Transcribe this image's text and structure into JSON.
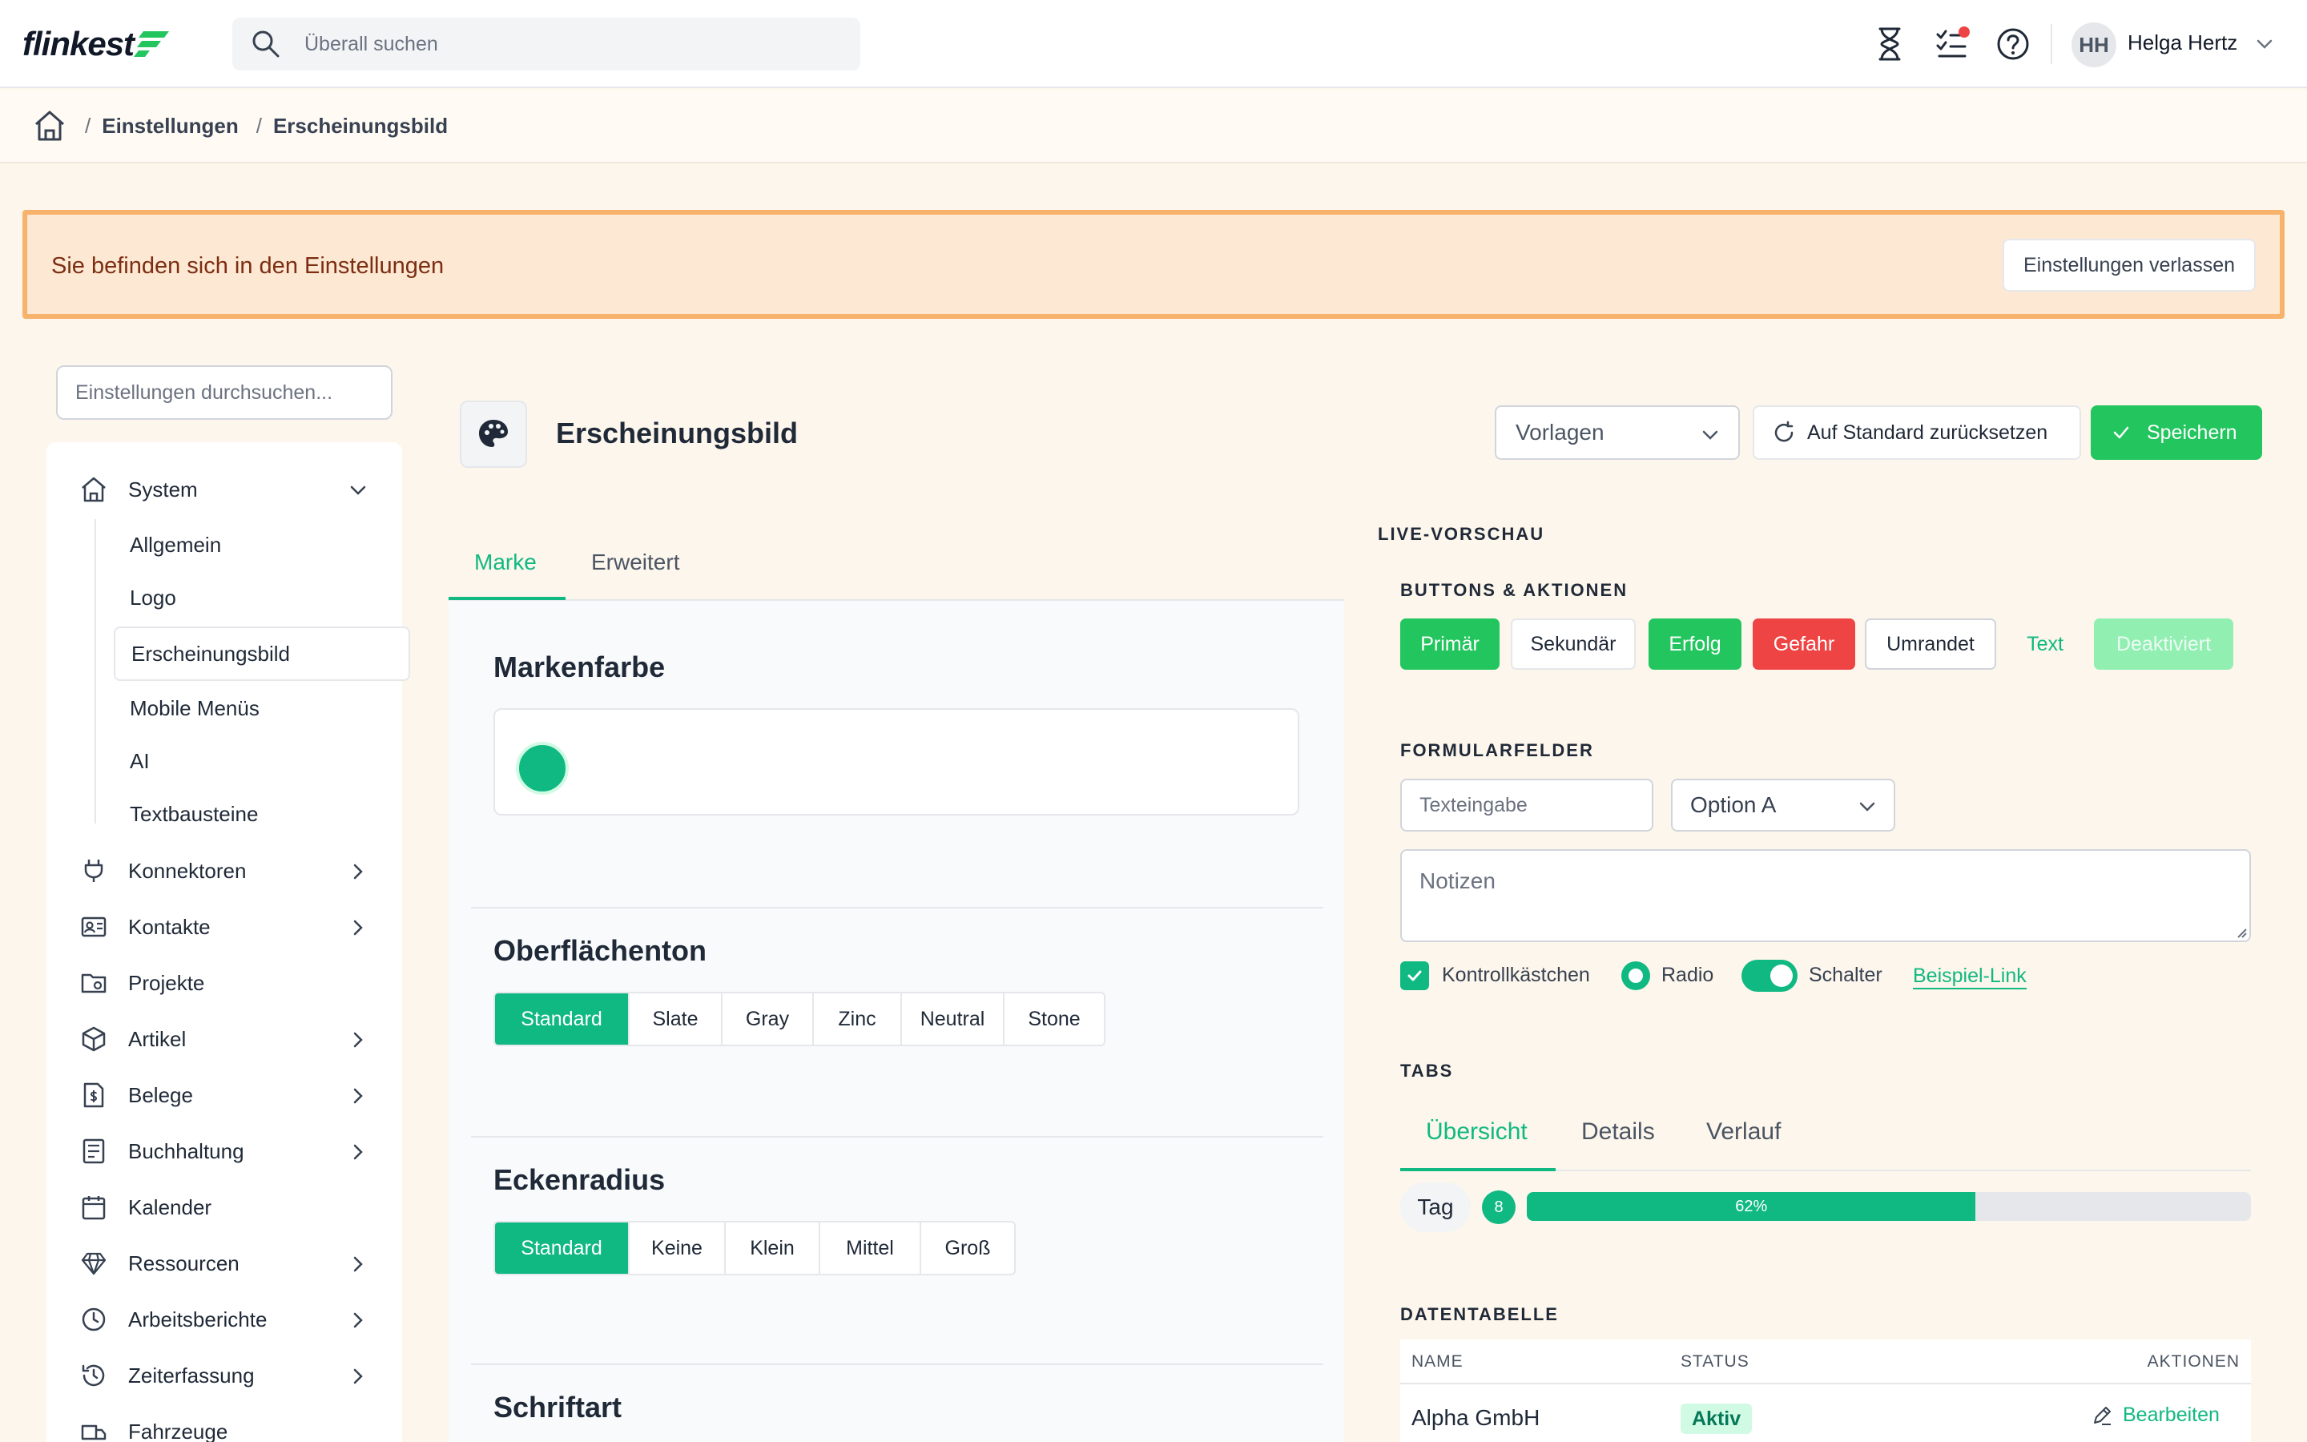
{
  "app": {
    "logo_text": "flinkest"
  },
  "search": {
    "placeholder": "Überall suchen"
  },
  "user": {
    "initials": "HH",
    "name": "Helga Hertz"
  },
  "breadcrumb": {
    "items": [
      "Einstellungen",
      "Erscheinungsbild"
    ]
  },
  "banner": {
    "text": "Sie befinden sich in den Einstellungen",
    "button": "Einstellungen verlassen"
  },
  "sidebar": {
    "search_placeholder": "Einstellungen durchsuchen...",
    "items": [
      {
        "label": "System",
        "icon": "home-icon",
        "expanded": true
      },
      {
        "label": "Konnektoren",
        "icon": "plug-icon"
      },
      {
        "label": "Kontakte",
        "icon": "contact-card-icon"
      },
      {
        "label": "Projekte",
        "icon": "folder-icon"
      },
      {
        "label": "Artikel",
        "icon": "box-icon"
      },
      {
        "label": "Belege",
        "icon": "receipt-icon"
      },
      {
        "label": "Buchhaltung",
        "icon": "ledger-icon"
      },
      {
        "label": "Kalender",
        "icon": "calendar-icon"
      },
      {
        "label": "Ressourcen",
        "icon": "diamond-icon"
      },
      {
        "label": "Arbeitsberichte",
        "icon": "clock-icon"
      },
      {
        "label": "Zeiterfassung",
        "icon": "history-icon"
      },
      {
        "label": "Fahrzeuge",
        "icon": "truck-icon"
      }
    ],
    "sub_items": [
      "Allgemein",
      "Logo",
      "Erscheinungsbild",
      "Mobile Menüs",
      "AI",
      "Textbausteine"
    ],
    "active_sub": "Erscheinungsbild"
  },
  "page": {
    "title": "Erscheinungsbild",
    "templates_select": "Vorlagen",
    "reset_label": "Auf Standard zurücksetzen",
    "save_label": "Speichern"
  },
  "tabs": [
    {
      "label": "Marke",
      "active": true
    },
    {
      "label": "Erweitert",
      "active": false
    }
  ],
  "sections": {
    "brand_color": {
      "title": "Markenfarbe",
      "value": "#10b981"
    },
    "surface": {
      "title": "Oberflächenton",
      "options": [
        "Standard",
        "Slate",
        "Gray",
        "Zinc",
        "Neutral",
        "Stone"
      ],
      "selected": "Standard"
    },
    "radius": {
      "title": "Eckenradius",
      "options": [
        "Standard",
        "Keine",
        "Klein",
        "Mittel",
        "Groß"
      ],
      "selected": "Standard"
    },
    "font": {
      "title": "Schriftart"
    }
  },
  "preview": {
    "title": "LIVE-VORSCHAU",
    "buttons_title": "BUTTONS & AKTIONEN",
    "buttons": {
      "primary": "Primär",
      "secondary": "Sekundär",
      "success": "Erfolg",
      "danger": "Gefahr",
      "outline": "Umrandet",
      "text": "Text",
      "disabled": "Deaktiviert"
    },
    "forms_title": "FORMULARFELDER",
    "text_placeholder": "Texteingabe",
    "select_value": "Option A",
    "notes_placeholder": "Notizen",
    "checkbox_label": "Kontrollkästchen",
    "radio_label": "Radio",
    "switch_label": "Schalter",
    "link_label": "Beispiel-Link",
    "tabs_title": "TABS",
    "tabs": [
      "Übersicht",
      "Details",
      "Verlauf"
    ],
    "tag": "Tag",
    "badge": "8",
    "progress": {
      "value": 0.62,
      "label": "62%"
    },
    "table_title": "DATENTABELLE",
    "table": {
      "headers": [
        "NAME",
        "STATUS",
        "AKTIONEN"
      ],
      "rows": [
        {
          "name": "Alpha GmbH",
          "status": "Aktiv",
          "action": "Bearbeiten"
        }
      ]
    }
  },
  "colors": {
    "accent": "#10b981",
    "success": "#22c55e",
    "danger": "#ef4444",
    "banner_bg": "#fde9d3",
    "banner_border": "#f7b26b"
  }
}
